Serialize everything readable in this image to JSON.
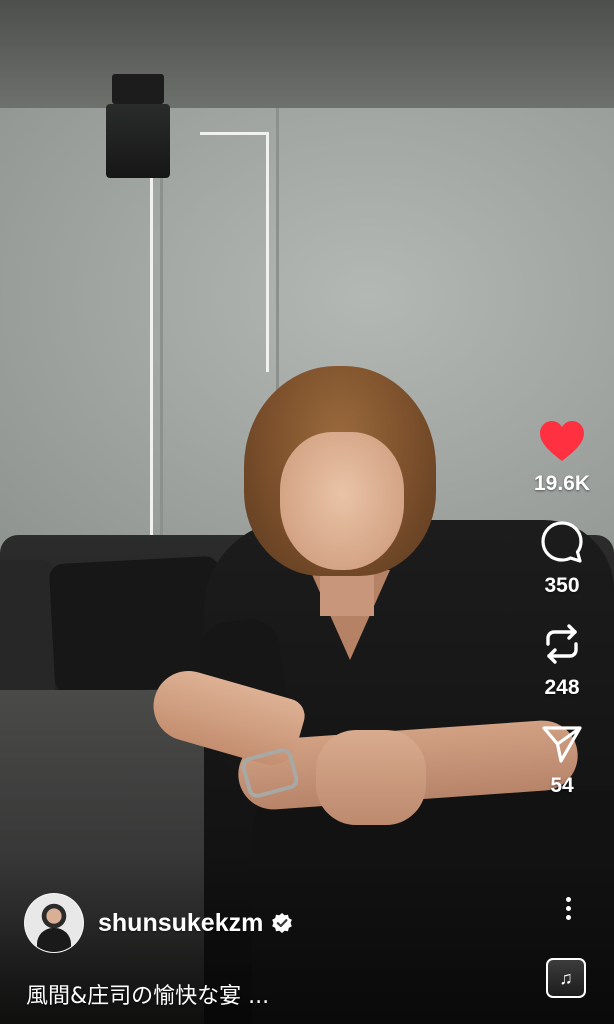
{
  "reel": {
    "likes": {
      "icon": "heart-filled-icon",
      "count": "19.6K",
      "color": "#ff3040"
    },
    "comments": {
      "icon": "comment-icon",
      "count": "350"
    },
    "reposts": {
      "icon": "repost-icon",
      "count": "248"
    },
    "shares": {
      "icon": "send-icon",
      "count": "54"
    },
    "more": {
      "icon": "more-vertical-icon"
    },
    "audio": {
      "icon": "audio-thumbnail-icon"
    }
  },
  "author": {
    "username": "shunsukekzm",
    "verified": true,
    "avatar": "profile-avatar"
  },
  "caption": {
    "text": "風間&庄司の愉快な宴 ..."
  }
}
